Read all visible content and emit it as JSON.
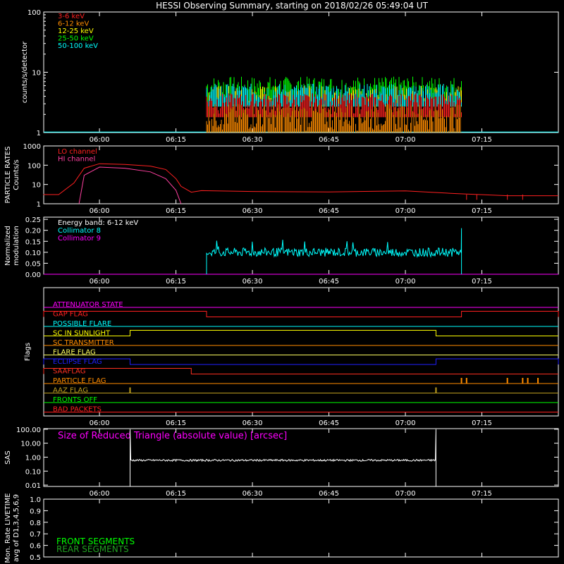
{
  "title": "HESSI Observing Summary, starting on 2018/02/26 05:49:04 UT",
  "colors": {
    "background": "#000000",
    "axis": "#ffffff",
    "e3_6": "#ff2020",
    "e6_12": "#ff8c00",
    "e12_25": "#ffff00",
    "e25_50": "#00ff00",
    "e50_100": "#00ffff",
    "lo_channel": "#ff2020",
    "hi_channel": "#ff40a0",
    "collimator8": "#00ffff",
    "collimator9": "#ff00ff",
    "sas": "#ffffff",
    "sas_title": "#ff00ff",
    "front_segments": "#00ff00",
    "rear_segments": "#20a020"
  },
  "time_ticks": [
    "06:00",
    "06:15",
    "06:30",
    "06:45",
    "07:00",
    "07:15"
  ],
  "chart_data": [
    {
      "type": "line",
      "name": "count_rates",
      "ylabel": "counts/s/detector",
      "yscale": "log",
      "ylim": [
        1,
        100
      ],
      "ytick_labels": [
        "1",
        "10",
        "100"
      ],
      "legend": [
        "3-6 keV",
        "6-12 keV",
        "12-25 keV",
        "25-50 keV",
        "50-100 keV"
      ],
      "legend_placement": "top-left",
      "x_range": [
        "05:49:04",
        "07:30"
      ],
      "data_window": [
        "06:21",
        "07:11"
      ],
      "series": [
        {
          "name": "3-6 keV",
          "approx_level": 3.0,
          "range": [
            2.0,
            4.5
          ]
        },
        {
          "name": "6-12 keV",
          "approx_level": 2.0,
          "range": [
            1.0,
            3.0
          ]
        },
        {
          "name": "12-25 keV",
          "approx_level": 4.0,
          "range": [
            3.0,
            6.0
          ]
        },
        {
          "name": "25-50 keV",
          "approx_level": 5.0,
          "range": [
            3.5,
            8.5
          ]
        },
        {
          "name": "50-100 keV",
          "approx_level": 4.5,
          "range": [
            3.0,
            6.5
          ]
        }
      ]
    },
    {
      "type": "line",
      "name": "particle_rates",
      "ylabel": "PARTICLE RATES Counts/s",
      "yscale": "log",
      "ylim": [
        1,
        1000
      ],
      "ytick_labels": [
        "1",
        "10",
        "100",
        "1000"
      ],
      "legend": [
        "LO channel",
        "HI channel"
      ],
      "series": [
        {
          "name": "LO channel",
          "x": [
            "05:49",
            "05:52",
            "05:55",
            "05:57",
            "06:00",
            "06:05",
            "06:10",
            "06:13",
            "06:15",
            "06:16",
            "06:18",
            "06:20",
            "06:30",
            "06:45",
            "07:00",
            "07:10",
            "07:20",
            "07:30"
          ],
          "y": [
            3,
            3,
            12,
            70,
            120,
            110,
            90,
            60,
            20,
            8,
            4,
            5,
            4,
            4,
            4,
            3.5,
            3,
            3
          ]
        },
        {
          "name": "HI channel",
          "x": [
            "05:56",
            "05:57",
            "06:00",
            "06:05",
            "06:10",
            "06:13",
            "06:15",
            "06:16"
          ],
          "y": [
            1,
            30,
            80,
            70,
            45,
            20,
            5,
            1
          ]
        }
      ]
    },
    {
      "type": "line",
      "name": "modulation",
      "ylabel": "Normalized modulation",
      "ylim": [
        0,
        0.25
      ],
      "ytick_labels": [
        "0.00",
        "0.05",
        "0.10",
        "0.15",
        "0.20",
        "0.25"
      ],
      "legend": [
        "Energy band: 6-12 keV",
        "Collimator 8",
        "Collimator 9"
      ],
      "series": [
        {
          "name": "Collimator 8",
          "range": [
            "06:21",
            "07:11"
          ],
          "approx_level": 0.1,
          "spike": {
            "x": "07:11",
            "y": 0.21
          }
        },
        {
          "name": "Collimator 9",
          "approx_level": 0.0
        }
      ]
    },
    {
      "type": "table",
      "name": "flags",
      "ylabel": "Flags",
      "rows": [
        {
          "label": "ATTENUATOR STATE",
          "color": "#ff00ff"
        },
        {
          "label": "GAP FLAG",
          "color": "#ff2020",
          "high": [
            [
              "05:49",
              "06:21"
            ],
            [
              "07:11",
              "07:30"
            ]
          ]
        },
        {
          "label": "POSSIBLE FLARE",
          "color": "#00ffff"
        },
        {
          "label": "SC IN SUNLIGHT",
          "color": "#ffff00",
          "high": [
            [
              "06:06",
              "07:06"
            ]
          ]
        },
        {
          "label": "SC TRANSMITTER",
          "color": "#ff8c00"
        },
        {
          "label": "FLARE FLAG",
          "color": "#ffff60"
        },
        {
          "label": "ECLIPSE FLAG",
          "color": "#2020ff",
          "high": [
            [
              "05:49",
              "06:06"
            ],
            [
              "07:06",
              "07:30"
            ]
          ]
        },
        {
          "label": "SAAFLAG",
          "color": "#ff3020",
          "high": [
            [
              "05:49",
              "06:18"
            ]
          ]
        },
        {
          "label": "PARTICLE FLAG",
          "color": "#ff8c00",
          "spikes": [
            "07:11",
            "07:12",
            "07:20",
            "07:23",
            "07:24",
            "07:26"
          ]
        },
        {
          "label": "AAZ FLAG",
          "color": "#c0a020",
          "spikes": [
            "06:06",
            "07:06"
          ]
        },
        {
          "label": "FRONTS OFF",
          "color": "#00ff00"
        },
        {
          "label": "BAD PACKETS",
          "color": "#ff2020"
        }
      ]
    },
    {
      "type": "line",
      "name": "sas",
      "ylabel": "SAS",
      "yscale": "log",
      "ylim": [
        0.01,
        100
      ],
      "ytick_labels": [
        "0.01",
        "0.10",
        "1.00",
        "10.00",
        "100.00"
      ],
      "annotation": "Size of Reduced Triangle (absolute value) [arcsec]",
      "series": [
        {
          "name": "SAS",
          "range": [
            "06:06",
            "07:06"
          ],
          "approx_level": 0.6,
          "spikes": [
            {
              "x": "06:06",
              "y": 100
            },
            {
              "x": "07:06",
              "y": 100
            }
          ]
        }
      ]
    },
    {
      "type": "line",
      "name": "livetime",
      "ylabel": "Mon. Rate LIVETIME avg of D1,3,4,5,6,9",
      "ylim": [
        0.5,
        1.0
      ],
      "ytick_labels": [
        "0.5",
        "0.6",
        "0.7",
        "0.8",
        "0.9",
        "1.0"
      ],
      "legend": [
        "FRONT SEGMENTS",
        "REAR SEGMENTS"
      ],
      "series": []
    }
  ]
}
